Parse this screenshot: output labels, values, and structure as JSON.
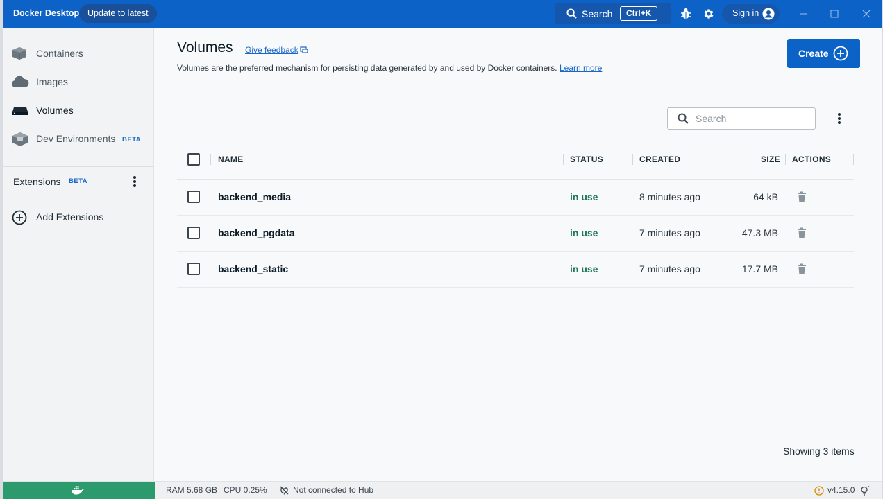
{
  "titlebar": {
    "app_title": "Docker Desktop",
    "update_label": "Update to latest",
    "search_label": "Search",
    "search_shortcut": "Ctrl+K",
    "signin_label": "Sign in",
    "accent_color": "#0c62c7"
  },
  "sidebar": {
    "items": [
      {
        "label": "Containers",
        "icon": "containers-icon"
      },
      {
        "label": "Images",
        "icon": "cloud-icon"
      },
      {
        "label": "Volumes",
        "icon": "volume-drive-icon",
        "active": true
      },
      {
        "label": "Dev Environments",
        "icon": "dev-env-icon",
        "badge": "BETA"
      }
    ],
    "extensions_label": "Extensions",
    "extensions_badge": "BETA",
    "add_extensions_label": "Add Extensions"
  },
  "main": {
    "title": "Volumes",
    "feedback_label": "Give feedback",
    "subtitle": "Volumes are the preferred mechanism for persisting data generated by and used by Docker containers.",
    "learn_more_label": "Learn more",
    "create_label": "Create",
    "search_placeholder": "Search",
    "table": {
      "headers": {
        "name": "NAME",
        "status": "STATUS",
        "created": "CREATED",
        "size": "SIZE",
        "actions": "ACTIONS"
      },
      "rows": [
        {
          "name": "backend_media",
          "status": "in use",
          "created": "8 minutes ago",
          "size": "64 kB"
        },
        {
          "name": "backend_pgdata",
          "status": "in use",
          "created": "7 minutes ago",
          "size": "47.3 MB"
        },
        {
          "name": "backend_static",
          "status": "in use",
          "created": "7 minutes ago",
          "size": "17.7 MB"
        }
      ]
    },
    "showing_label": "Showing 3 items"
  },
  "statusbar": {
    "ram": "RAM 5.68 GB",
    "cpu": "CPU 0.25%",
    "hub_status": "Not connected to Hub",
    "version": "v4.15.0",
    "status_color": "#2d9a6e"
  }
}
